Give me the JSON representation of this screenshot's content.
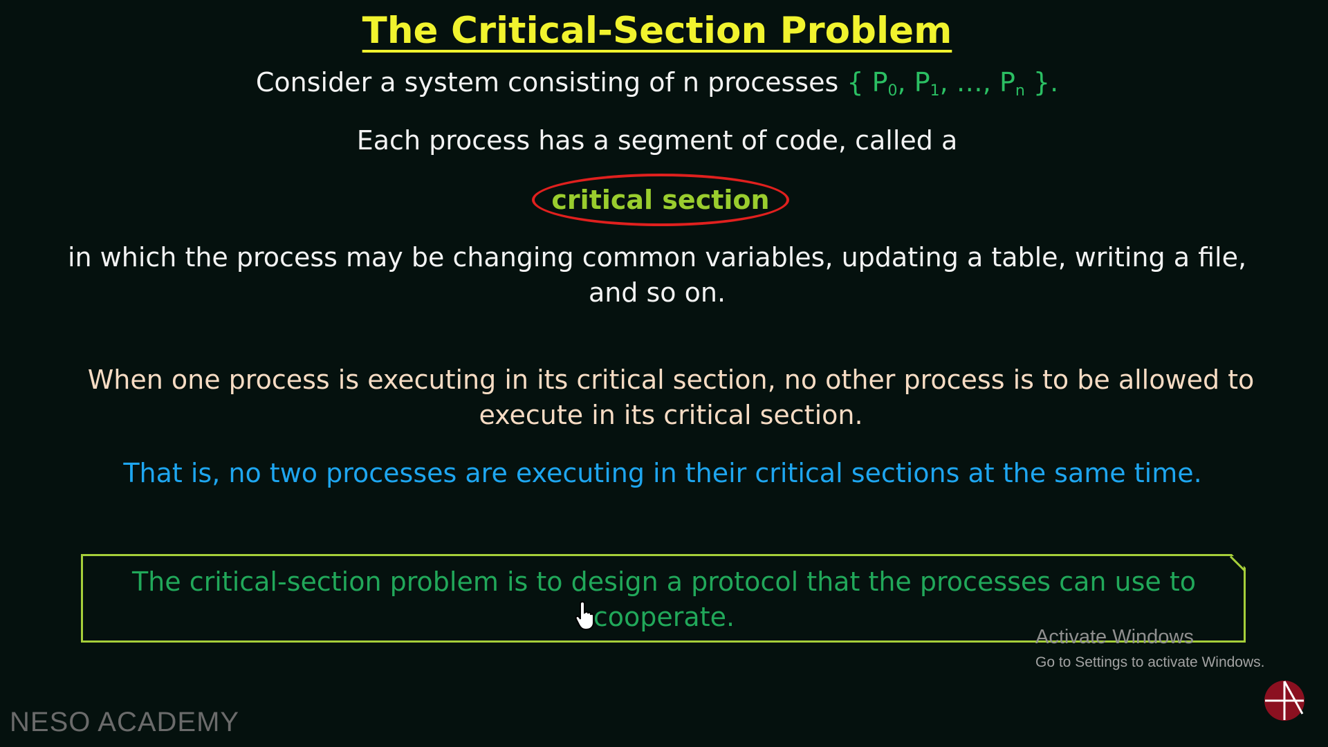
{
  "slide": {
    "title": "The Critical-Section Problem",
    "line1_text": "Consider a system consisting of n processes ",
    "line1_set_open": "{ P",
    "line1_set_sub0": "0",
    "line1_set_mid1": ", P",
    "line1_set_sub1": "1",
    "line1_set_mid2": ", …, P",
    "line1_set_subn": "n",
    "line1_set_close": " }.",
    "line2": "Each process has a segment of code, called a",
    "highlight": "critical section",
    "line3a": "in which the process may be changing common variables, updating a table, writing a file,",
    "line3b": "and so on.",
    "line4a": "When one process is executing in its critical section, no other process is to be allowed to",
    "line4b": "execute in its critical section.",
    "line5": "That is, no two processes are executing in their critical sections at the same time.",
    "box_line1": "The critical-section problem is to design a protocol that the processes can use to",
    "box_line2": "cooperate."
  },
  "overlay": {
    "activate_title": "Activate Windows",
    "activate_sub": "Go to Settings to activate Windows.",
    "watermark": "NESO ACADEMY",
    "logo_icon": "neso-logo-icon",
    "cursor_icon": "hand-cursor-icon"
  },
  "colors": {
    "background": "#05110e",
    "title": "#f1f32e",
    "set": "#2bbf63",
    "oval": "#e0201e",
    "highlight": "#9acd2e",
    "peach": "#f7dcc4",
    "blue": "#1ea6f0",
    "box_border": "#a6cf3a",
    "box_text": "#21a85a"
  }
}
